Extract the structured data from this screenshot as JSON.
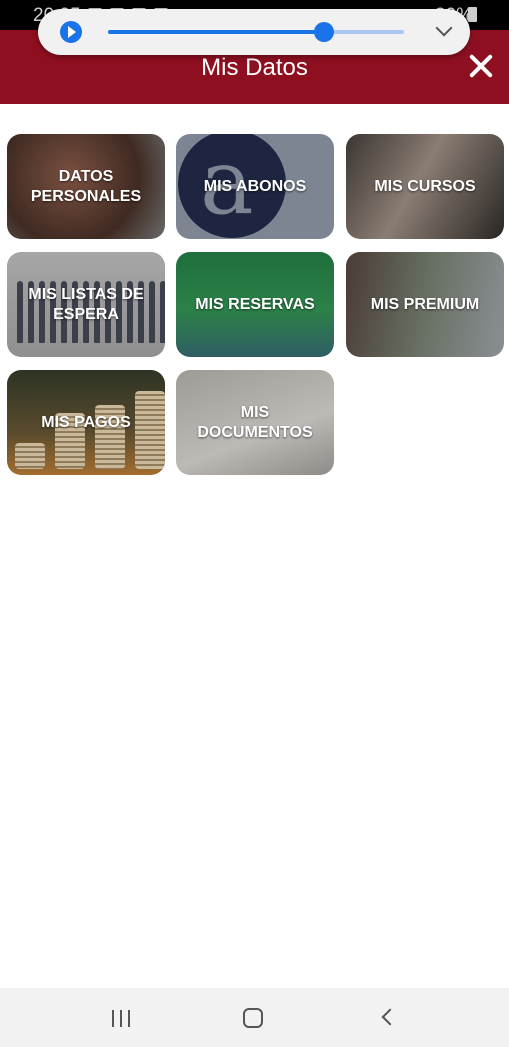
{
  "status_bar": {
    "time": "20:05",
    "right_text": "30%"
  },
  "header": {
    "title": "Mis Datos"
  },
  "media": {
    "progress": 0.73
  },
  "tiles": [
    {
      "label": "DATOS PERSONALES"
    },
    {
      "label": "MIS ABONOS",
      "logo_letter": "a"
    },
    {
      "label": "MIS CURSOS"
    },
    {
      "label": "MIS LISTAS DE ESPERA"
    },
    {
      "label": "MIS RESERVAS"
    },
    {
      "label": "MIS PREMIUM"
    },
    {
      "label": "MIS PAGOS"
    },
    {
      "label": "MIS DOCUMENTOS"
    }
  ],
  "colors": {
    "header": "#8e1020",
    "accent": "#1a73e8"
  },
  "icons": {
    "close": "close-icon",
    "play": "play-icon",
    "collapse": "chevron-down-icon"
  }
}
